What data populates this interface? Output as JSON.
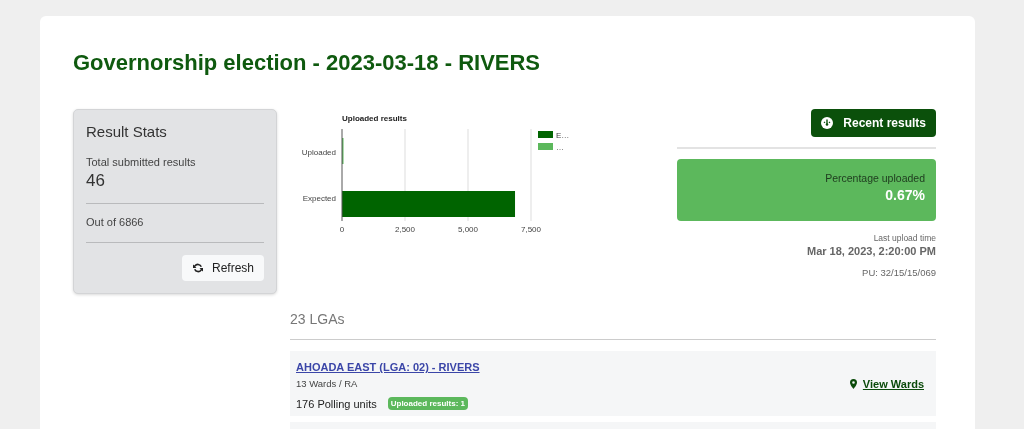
{
  "title": "Governorship election - 2023-03-18 - RIVERS",
  "result_stats": {
    "heading": "Result Stats",
    "total_label": "Total submitted results",
    "total_value": "46",
    "out_of": "Out of 6866",
    "refresh_button": "Refresh"
  },
  "chart_data": {
    "type": "bar",
    "orientation": "horizontal",
    "title": "Uploaded results",
    "categories": [
      "Uploaded",
      "Expected"
    ],
    "series": [
      {
        "name": "E…",
        "color": "#006400",
        "values": [
          null,
          6866
        ]
      },
      {
        "name": "…",
        "color": "#5cb85c",
        "values": [
          46,
          null
        ]
      }
    ],
    "legend": true,
    "xlim": [
      0,
      7500
    ],
    "xticks": [
      {
        "value": 0,
        "label": "0"
      },
      {
        "value": 2500,
        "label": "2,500"
      },
      {
        "value": 5000,
        "label": "5,000"
      },
      {
        "value": 7500,
        "label": "7,500"
      }
    ]
  },
  "recent_results_button": "Recent results",
  "percentage": {
    "label": "Percentage uploaded",
    "value": "0.67%"
  },
  "last_upload": {
    "label": "Last upload time",
    "time": "Mar 18, 2023, 2:20:00 PM",
    "pu": "PU: 32/15/15/069"
  },
  "lga_heading": "23 LGAs",
  "lgas": [
    {
      "name": "AHOADA EAST (LGA: 02) - RIVERS",
      "wards": "13 Wards / RA",
      "polling_units": "176 Polling units",
      "badge": "Uploaded results: 1",
      "link": "View Wards"
    }
  ]
}
